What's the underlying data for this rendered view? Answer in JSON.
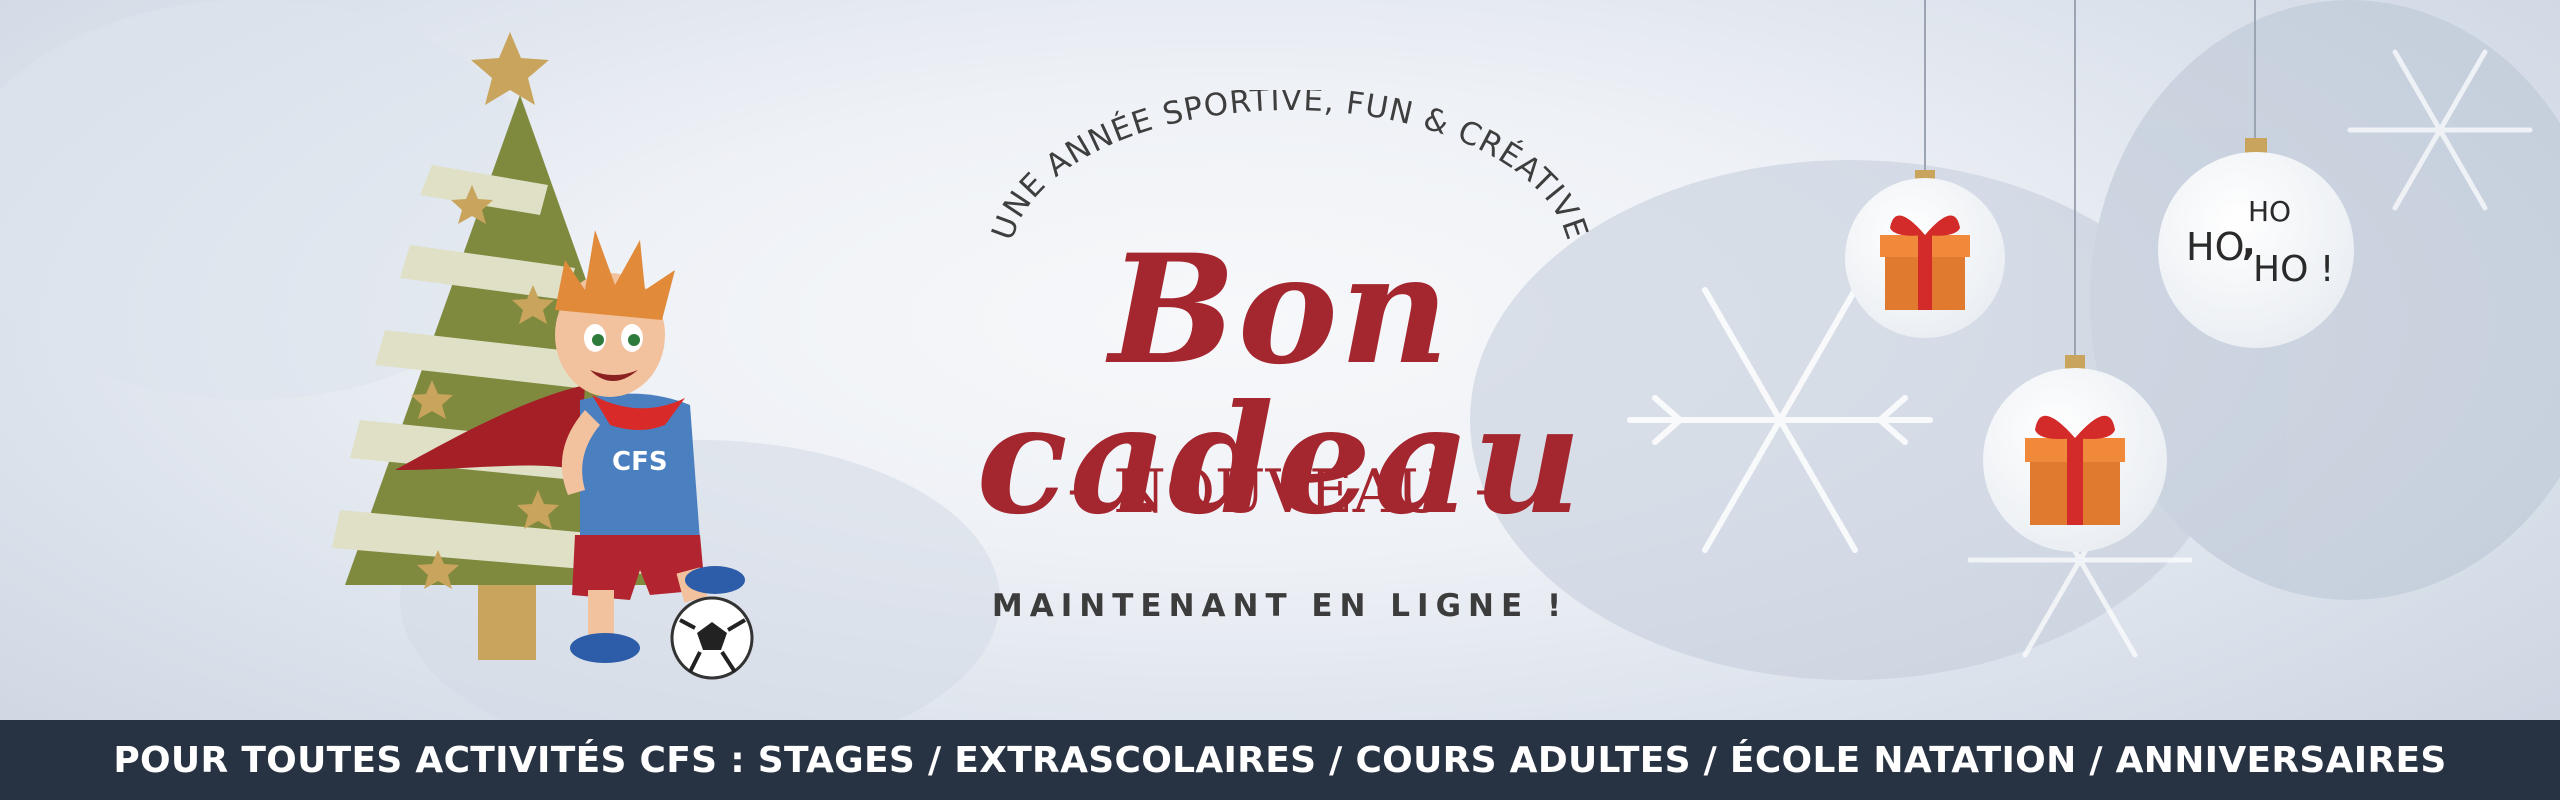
{
  "banner": {
    "arc_text": "UNE ANNÉE SPORTIVE, FUN & CRÉATIVE",
    "title": "Bon cadeau",
    "badge_dash_left": "-",
    "badge": "NOUVEAU",
    "badge_dash_right": "-",
    "subline": "MAINTENANT EN LIGNE !",
    "mascot_shirt_text": "CFS",
    "ornament_ho_1": "HO",
    "ornament_ho_2": "HO",
    "ornament_ho_3": "HO !",
    "ornament_comma": ","
  },
  "bottom_bar": {
    "text": "POUR TOUTES ACTIVITÉS CFS : STAGES / EXTRASCOLAIRES / COURS ADULTES / ÉCOLE NATATION / ANNIVERSAIRES"
  },
  "colors": {
    "title_red": "#a4262f",
    "bar_navy": "#273242",
    "tree_green": "#7f8a3f",
    "star_gold": "#c9a45c",
    "gift_orange": "#e07a2e",
    "ribbon_red": "#d32a2a"
  },
  "icons": [
    "christmas-tree-icon",
    "star-icon",
    "mascot-boy",
    "soccer-ball-icon",
    "gift-ornament-icon",
    "ho-ho-ho-ornament",
    "snowflake-icon"
  ]
}
